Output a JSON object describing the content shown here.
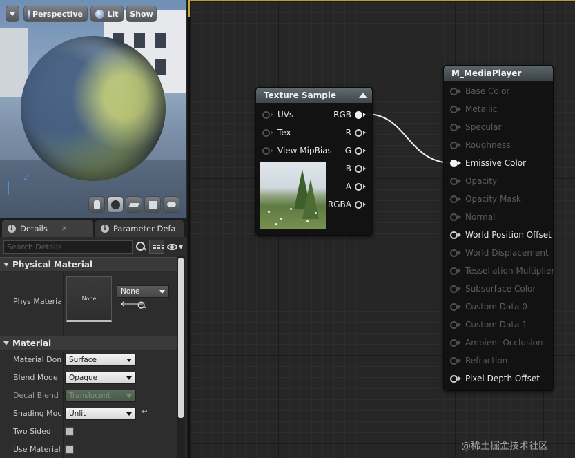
{
  "viewport": {
    "menu_icon": "chevron-down-icon",
    "buttons": {
      "perspective": "Perspective",
      "lit": "Lit",
      "show": "Show"
    },
    "axis_label": "Z",
    "shape_buttons": [
      "cylinder-icon",
      "sphere-icon",
      "plane-icon",
      "cube-icon",
      "custom-mesh-icon"
    ]
  },
  "details": {
    "tabs": [
      {
        "label": "Details",
        "icon": "info-icon",
        "active": true
      },
      {
        "label": "Parameter Defa",
        "icon": "info-icon",
        "active": false
      }
    ],
    "search": {
      "placeholder": "Search Details"
    },
    "physical_material": {
      "header": "Physical Material",
      "label": "Phys Material",
      "thumbnail_text": "None",
      "value": "None"
    },
    "material": {
      "header": "Material",
      "rows": [
        {
          "label": "Material Doma",
          "value": "Surface",
          "type": "dropdown"
        },
        {
          "label": "Blend Mode",
          "value": "Opaque",
          "type": "dropdown"
        },
        {
          "label": "Decal Blend M",
          "value": "Translucent",
          "type": "dropdown-disabled"
        },
        {
          "label": "Shading Mode",
          "value": "Unlit",
          "type": "dropdown-reset"
        },
        {
          "label": "Two Sided",
          "type": "checkbox"
        },
        {
          "label": "Use Material A",
          "type": "checkbox"
        }
      ]
    }
  },
  "graph": {
    "texture_sample": {
      "title": "Texture Sample",
      "inputs": [
        "UVs",
        "Tex",
        "View MipBias"
      ],
      "outputs": [
        "RGB",
        "R",
        "G",
        "B",
        "A",
        "RGBA"
      ]
    },
    "material_node": {
      "title": "M_MediaPlayer",
      "pins": [
        {
          "label": "Base Color",
          "active": false
        },
        {
          "label": "Metallic",
          "active": false
        },
        {
          "label": "Specular",
          "active": false
        },
        {
          "label": "Roughness",
          "active": false
        },
        {
          "label": "Emissive Color",
          "active": true,
          "connected": true
        },
        {
          "label": "Opacity",
          "active": false
        },
        {
          "label": "Opacity Mask",
          "active": false
        },
        {
          "label": "Normal",
          "active": false
        },
        {
          "label": "World Position Offset",
          "active": true
        },
        {
          "label": "World Displacement",
          "active": false
        },
        {
          "label": "Tessellation Multiplier",
          "active": false
        },
        {
          "label": "Subsurface Color",
          "active": false
        },
        {
          "label": "Custom Data 0",
          "active": false
        },
        {
          "label": "Custom Data 1",
          "active": false
        },
        {
          "label": "Ambient Occlusion",
          "active": false
        },
        {
          "label": "Refraction",
          "active": false
        },
        {
          "label": "Pixel Depth Offset",
          "active": true
        }
      ]
    },
    "connection": {
      "from": "RGB",
      "to": "Emissive Color",
      "color": "#f0f0f0"
    }
  },
  "watermark": "@稀土掘金技术社区",
  "colors": {
    "graph_bg": "#262626",
    "node_body": "#121212",
    "node_header": "#5a666c",
    "active_pin": "#f2f2f2",
    "inactive_pin": "#5b5b5b"
  }
}
